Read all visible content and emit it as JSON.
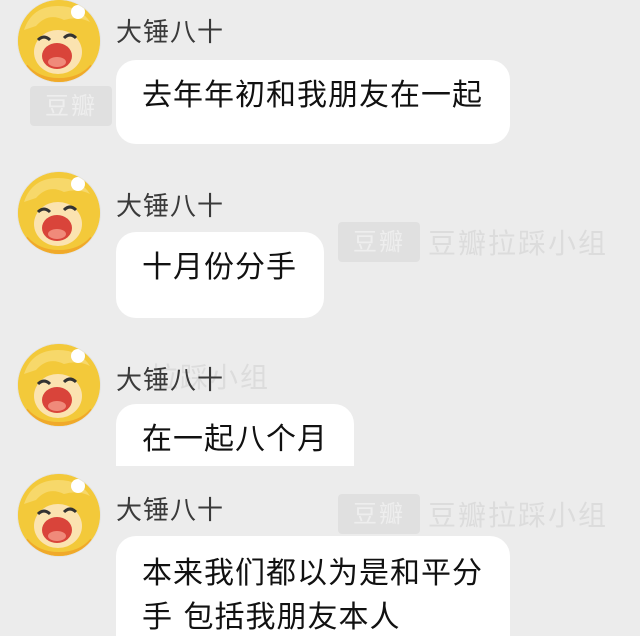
{
  "messages": [
    {
      "sender": "大锤八十",
      "text": "去年年初和我朋友在一起"
    },
    {
      "sender": "大锤八十",
      "text": "十月份分手"
    },
    {
      "sender": "大锤八十",
      "text": "在一起八个月"
    },
    {
      "sender": "大锤八十",
      "text_line1": "本来我们都以为是和平分",
      "text_line2": "手 包括我朋友本人"
    }
  ],
  "watermark": {
    "logo": "豆瓣",
    "text": "豆瓣拉踩小组",
    "text_short": "拉踩小组"
  },
  "colors": {
    "background": "#ececec",
    "bubble": "#ffffff",
    "avatar": "#f3c93a"
  }
}
